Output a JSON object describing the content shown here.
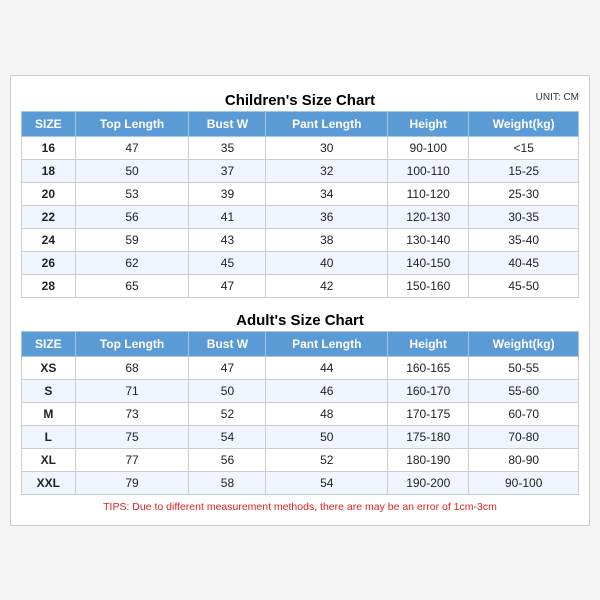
{
  "childrenTitle": "Children's Size Chart",
  "adultTitle": "Adult's Size Chart",
  "unitLabel": "UNIT: CM",
  "headers": [
    "SIZE",
    "Top Length",
    "Bust W",
    "Pant Length",
    "Height",
    "Weight(kg)"
  ],
  "childrenRows": [
    [
      "16",
      "47",
      "35",
      "30",
      "90-100",
      "<15"
    ],
    [
      "18",
      "50",
      "37",
      "32",
      "100-110",
      "15-25"
    ],
    [
      "20",
      "53",
      "39",
      "34",
      "110-120",
      "25-30"
    ],
    [
      "22",
      "56",
      "41",
      "36",
      "120-130",
      "30-35"
    ],
    [
      "24",
      "59",
      "43",
      "38",
      "130-140",
      "35-40"
    ],
    [
      "26",
      "62",
      "45",
      "40",
      "140-150",
      "40-45"
    ],
    [
      "28",
      "65",
      "47",
      "42",
      "150-160",
      "45-50"
    ]
  ],
  "adultRows": [
    [
      "XS",
      "68",
      "47",
      "44",
      "160-165",
      "50-55"
    ],
    [
      "S",
      "71",
      "50",
      "46",
      "160-170",
      "55-60"
    ],
    [
      "M",
      "73",
      "52",
      "48",
      "170-175",
      "60-70"
    ],
    [
      "L",
      "75",
      "54",
      "50",
      "175-180",
      "70-80"
    ],
    [
      "XL",
      "77",
      "56",
      "52",
      "180-190",
      "80-90"
    ],
    [
      "XXL",
      "79",
      "58",
      "54",
      "190-200",
      "90-100"
    ]
  ],
  "tips": "TIPS: Due to different measurement methods, there are may be an error of 1cm-3cm"
}
